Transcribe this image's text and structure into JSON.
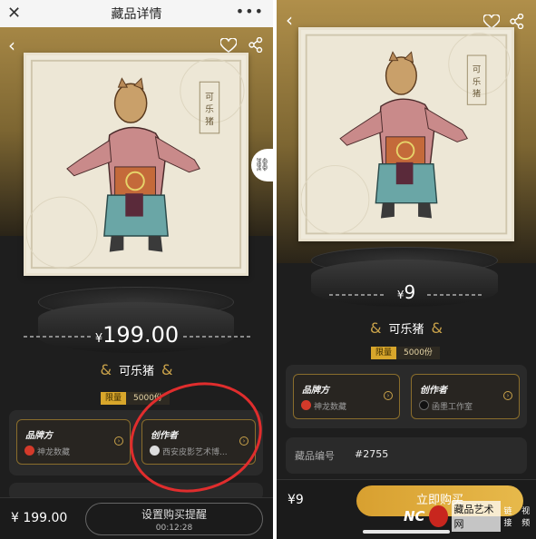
{
  "left": {
    "topbar": {
      "title": "藏品详情",
      "close": "✕",
      "more": "•••"
    },
    "price": "199.00",
    "currency": "¥",
    "name": "可乐猪",
    "limit": {
      "tag": "限量",
      "count": "5000份"
    },
    "brand": {
      "title": "品牌方",
      "value": "神龙数藏"
    },
    "creator": {
      "title": "创作者",
      "value": "西安皮影艺术博..."
    },
    "bottom": {
      "price": "¥ 199.00",
      "remind_label": "设置购买提醒",
      "countdown": "00:12:28"
    },
    "art_caption": "可乐猪"
  },
  "right": {
    "price": "9",
    "currency": "¥",
    "name": "可乐猪",
    "limit": {
      "tag": "限量",
      "count": "5000份"
    },
    "brand": {
      "title": "品牌方",
      "value": "神龙数藏"
    },
    "creator": {
      "title": "创作者",
      "value": "函墨工作室"
    },
    "serial": {
      "label": "藏品编号",
      "value": "#2755"
    },
    "bottom": {
      "price": "¥9",
      "buy_label": "立即购买"
    },
    "art_caption": "可乐猪"
  },
  "watermark": {
    "brand": "NC",
    "site": "藏品艺术网",
    "link": "链接",
    "video": "视频"
  },
  "colors": {
    "gold": "#c9a24a",
    "accent": "#d8a62b",
    "annotation": "#e02d2d"
  }
}
